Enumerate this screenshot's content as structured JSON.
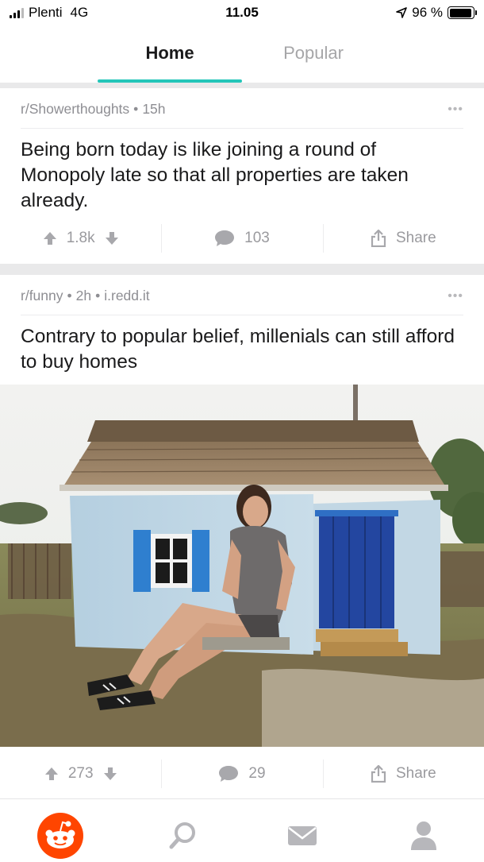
{
  "status_bar": {
    "carrier": "Plenti",
    "network": "4G",
    "time": "11.05",
    "battery": "96 %",
    "battery_level": 0.96
  },
  "tabs": [
    {
      "label": "Home",
      "active": true
    },
    {
      "label": "Popular",
      "active": false
    }
  ],
  "colors": {
    "accent": "#24c6b9",
    "reddit_orange": "#ff4500",
    "meta_gray": "#8e8e93",
    "action_gray": "#9a9a9e"
  },
  "posts": [
    {
      "subreddit": "r/Showerthoughts",
      "age": "15h",
      "domain": "",
      "title": "Being born today is like joining a round of Monopoly late so that all properties are taken already.",
      "votes": "1.8k",
      "comments": "103",
      "share_label": "Share",
      "has_image": false
    },
    {
      "subreddit": "r/funny",
      "age": "2h",
      "domain": "i.redd.it",
      "title": "Contrary to popular belief, millenials can still afford to buy homes",
      "votes": "273",
      "comments": "29",
      "share_label": "Share",
      "has_image": true
    }
  ],
  "icons": {
    "upvote": "upvote-arrow-icon",
    "downvote": "downvote-arrow-icon",
    "comment": "comment-bubble-icon",
    "share": "share-icon",
    "more": "more-dots-icon",
    "nav": [
      "reddit-home-icon",
      "search-icon",
      "mail-icon",
      "profile-icon"
    ]
  }
}
